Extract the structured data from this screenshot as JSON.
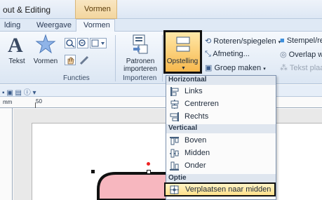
{
  "window": {
    "title": "out & Editing",
    "context_tab": "Vormen"
  },
  "tabs": [
    {
      "label": "lding"
    },
    {
      "label": "Weergave"
    },
    {
      "label": "Vormen"
    }
  ],
  "ribbon": {
    "groups": {
      "functies": "Functies",
      "importeren": "Importeren"
    },
    "buttons": {
      "tekst": "Tekst",
      "vormen": "Vormen",
      "patronen": "Patronen",
      "importeren": "importeren",
      "opstelling": "Opstelling",
      "roteren": "Roteren/spiegelen",
      "afmeting": "Afmeting...",
      "groep": "Groep maken",
      "stempel": "Stempel/re",
      "overlap": "Overlap wi",
      "tekst_plaats": "Tekst plaats"
    }
  },
  "ruler": {
    "mark_50": "50",
    "unit": "mm"
  },
  "dropdown": {
    "sections": [
      {
        "heading": "Horizontaal",
        "items": [
          "Links",
          "Centreren",
          "Rechts"
        ]
      },
      {
        "heading": "Verticaal",
        "items": [
          "Boven",
          "Midden",
          "Onder"
        ]
      },
      {
        "heading": "Optie",
        "items": [
          "Verplaatsen naar midden"
        ]
      }
    ]
  },
  "colors": {
    "accent_orange": "#f7b84d",
    "shape_pink": "#f7b7bf",
    "highlight": "#ffe08a"
  }
}
